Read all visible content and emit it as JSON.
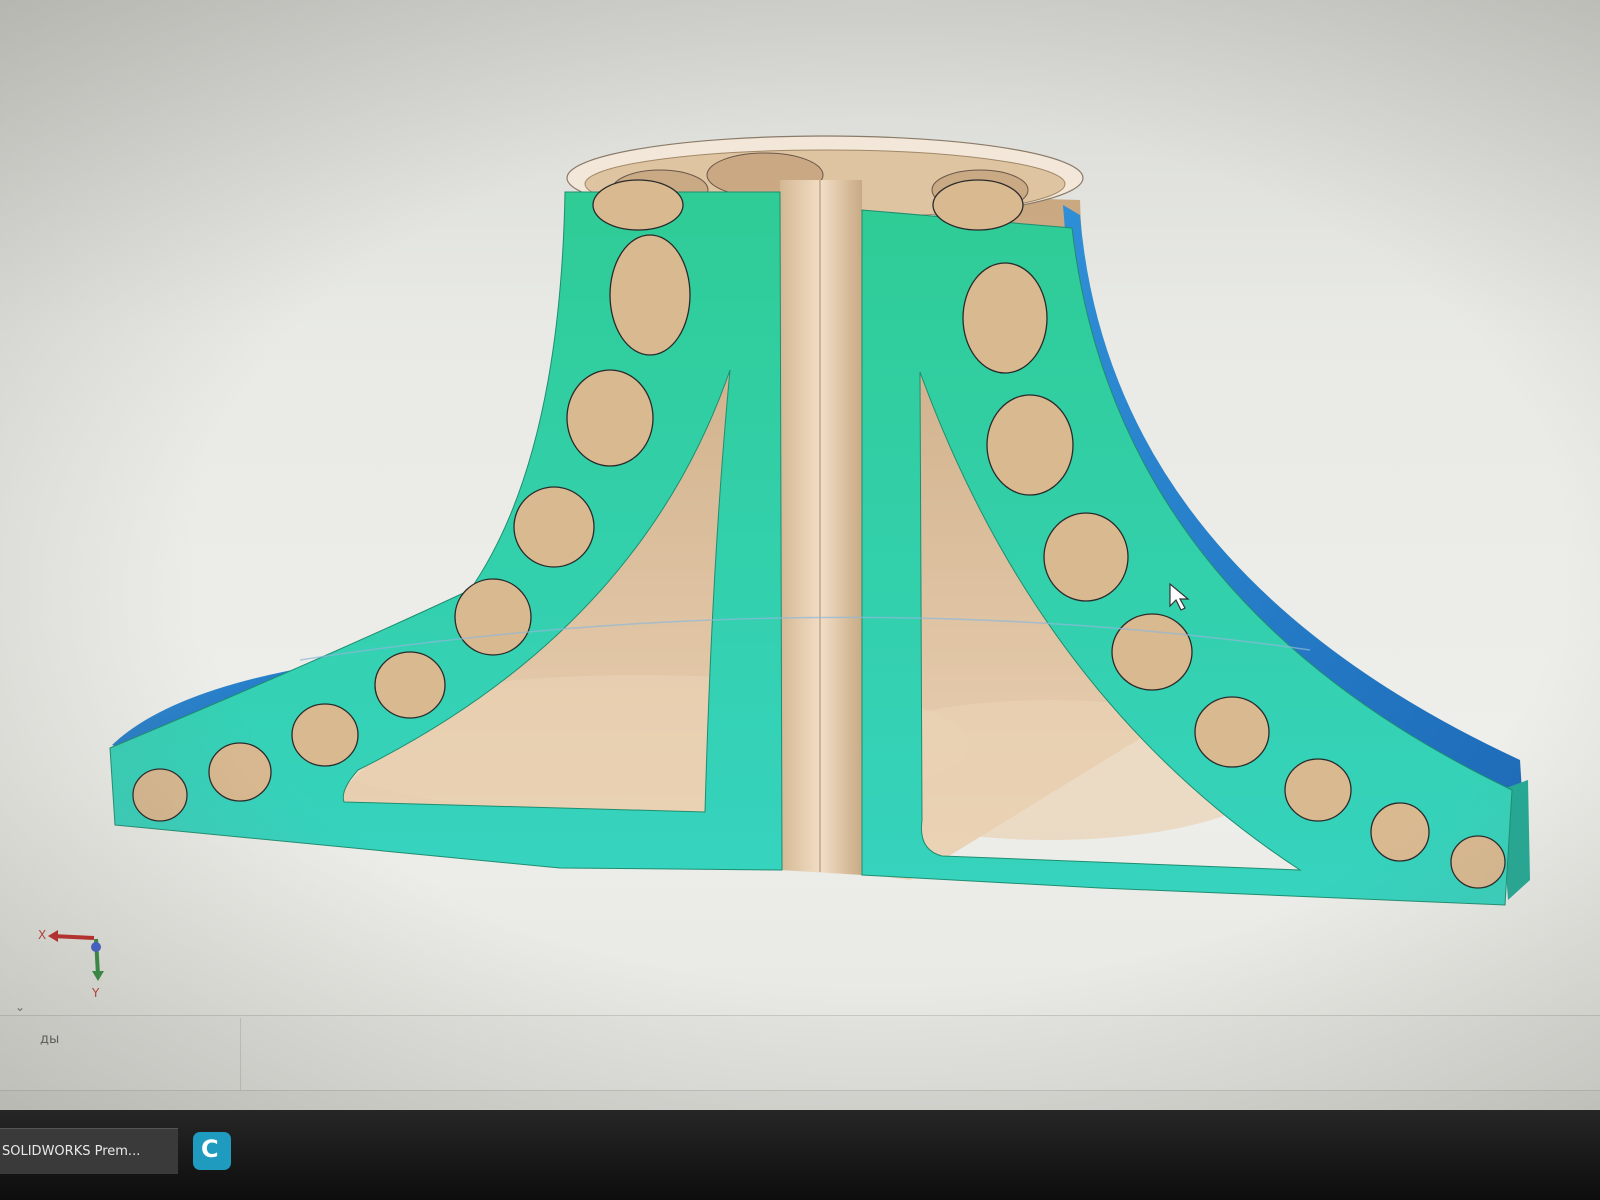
{
  "viewport": {
    "model": "revolved flange part, section view",
    "colors": {
      "background": "#e9eae6",
      "section_face": "#2fd3a8",
      "outer_surface": "#2580c8",
      "inner_surface": "#dcc0a0"
    },
    "triad": {
      "x_label": "X",
      "y_label": "Y"
    }
  },
  "panel": {
    "tab_label": "ды"
  },
  "taskbar": {
    "items": [
      {
        "label": "SOLIDWORKS Prem..."
      }
    ],
    "app_icon": {
      "name": "c-app-icon",
      "glyph": "C",
      "color": "#1f9bc0"
    }
  }
}
